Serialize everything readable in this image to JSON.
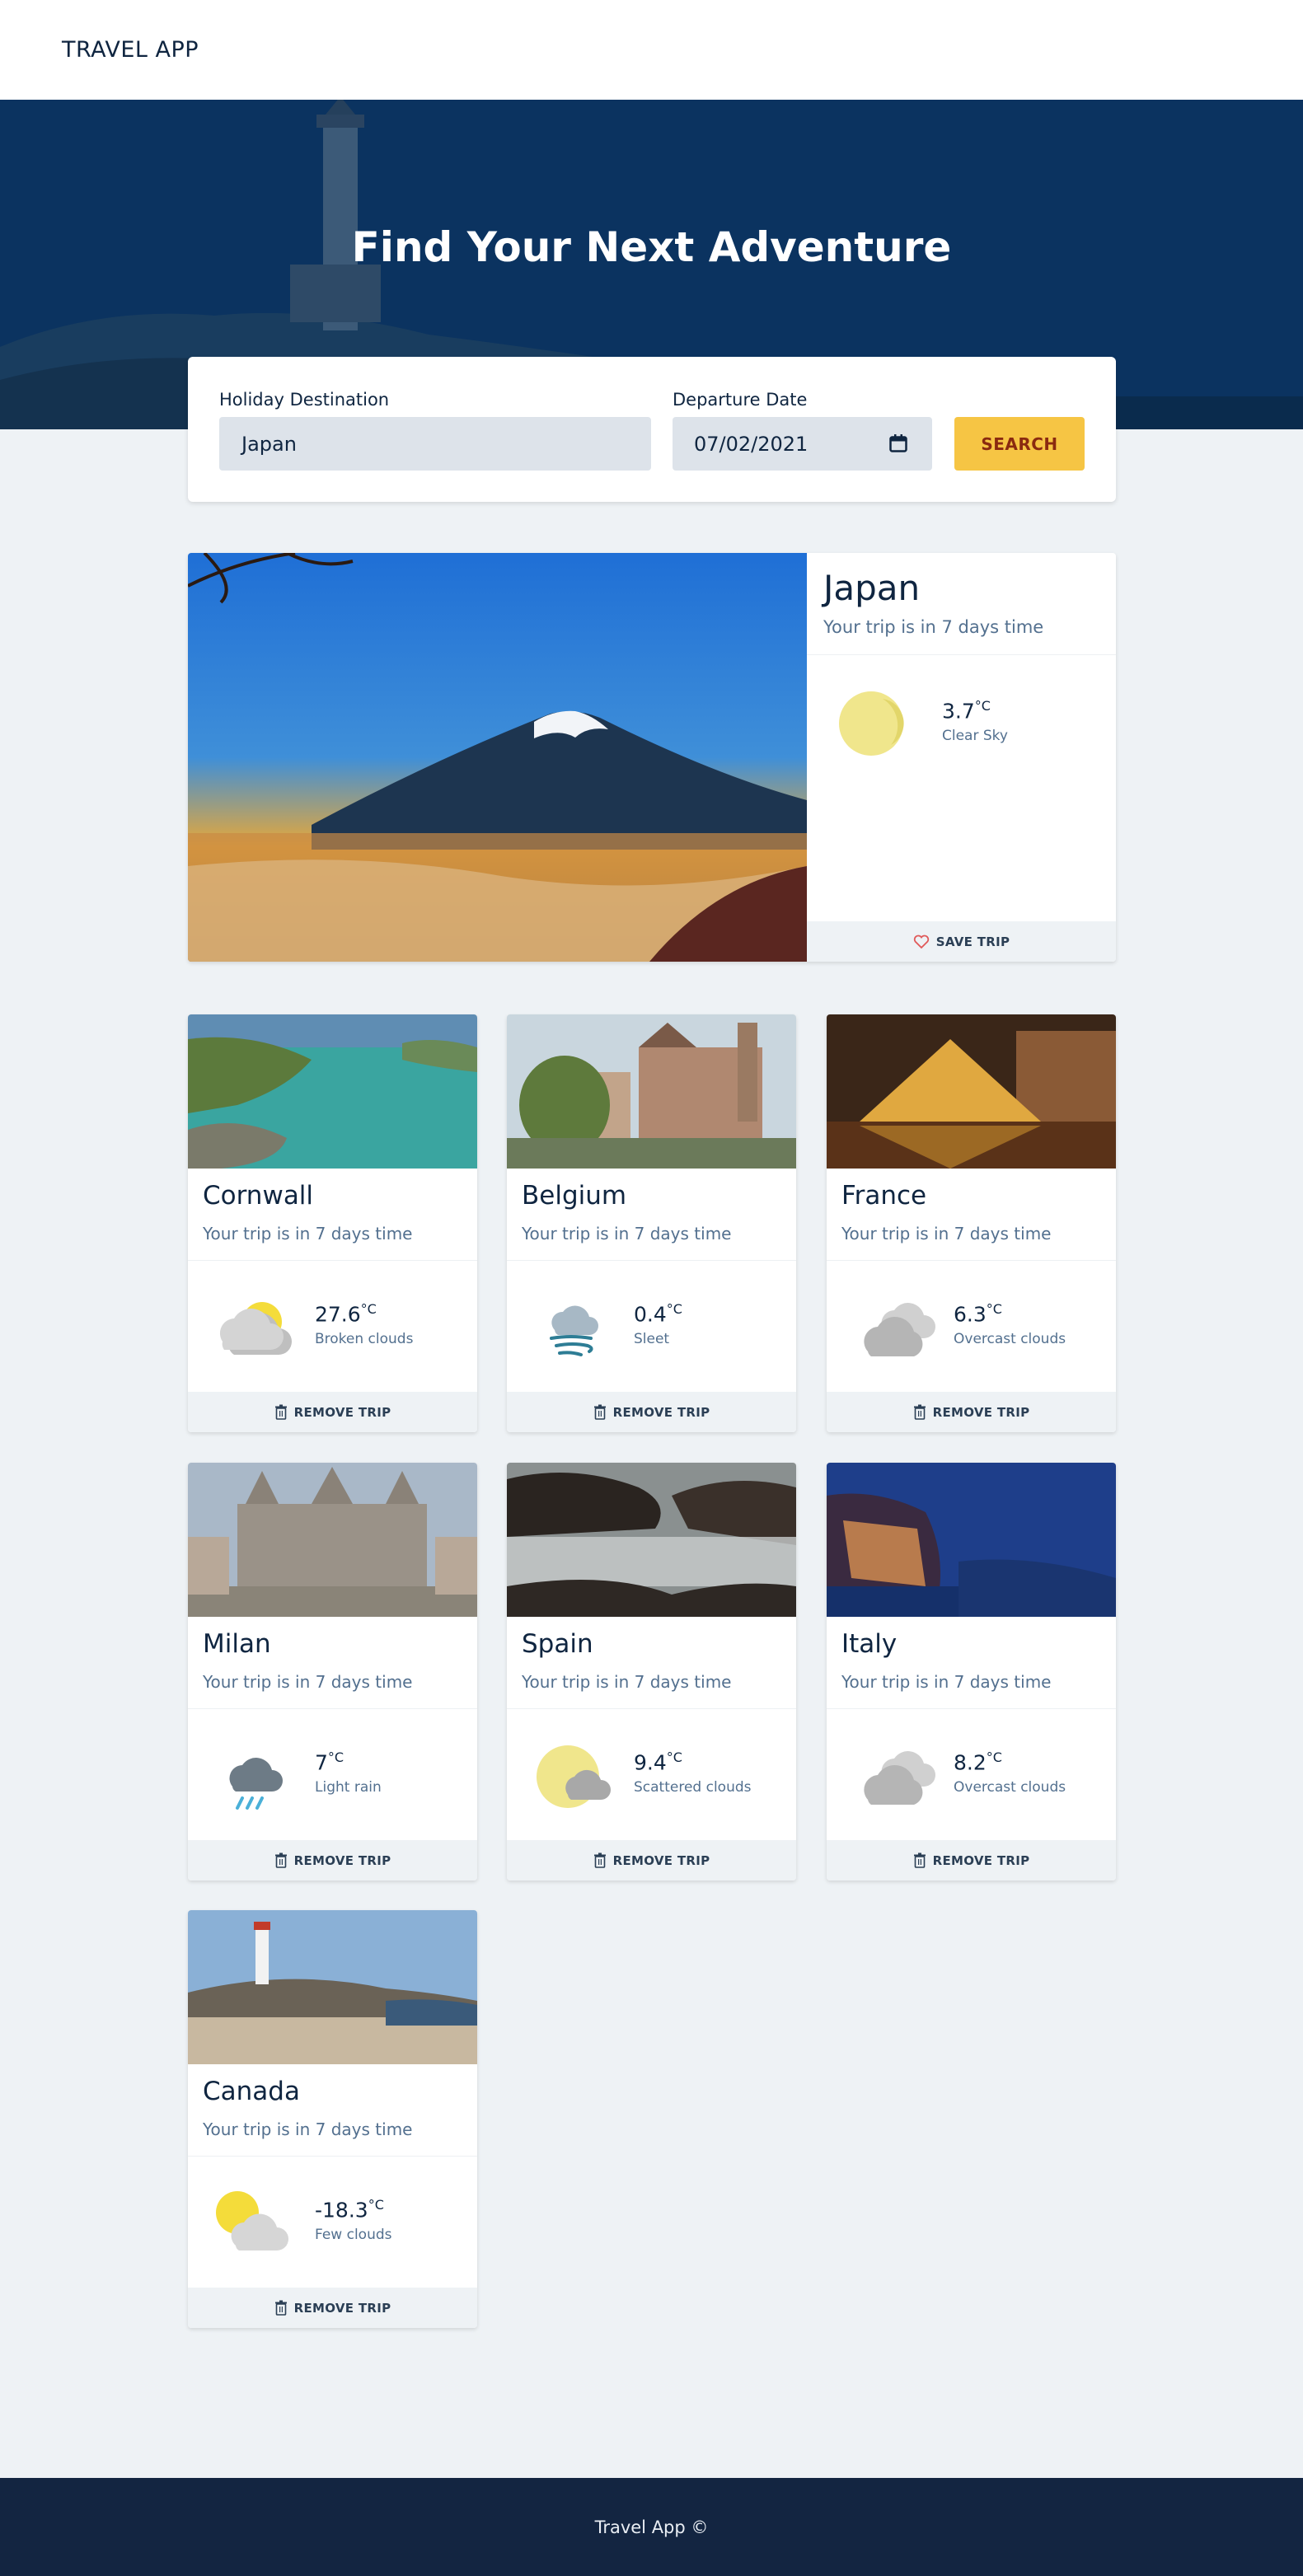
{
  "app": {
    "brand": "TRAVEL APP"
  },
  "hero": {
    "title": "Find Your Next Adventure"
  },
  "search": {
    "destination_label": "Holiday Destination",
    "destination_value": "Japan",
    "date_label": "Departure Date",
    "date_value": "07/02/2021",
    "button_label": "SEARCH"
  },
  "featured": {
    "title": "Japan",
    "subtitle": "Your trip is in 7 days time",
    "temp": "3.7",
    "unit": "°C",
    "desc": "Clear Sky",
    "weather_icon": "sun-icon",
    "action_label": "SAVE TRIP",
    "action_icon": "heart-icon"
  },
  "trips": [
    {
      "title": "Cornwall",
      "subtitle": "Your trip is in 7 days time",
      "temp": "27.6",
      "unit": "°C",
      "desc": "Broken clouds",
      "weather_icon": "broken-clouds-icon",
      "action_label": "REMOVE TRIP"
    },
    {
      "title": "Belgium",
      "subtitle": "Your trip is in 7 days time",
      "temp": "0.4",
      "unit": "°C",
      "desc": "Sleet",
      "weather_icon": "sleet-icon",
      "action_label": "REMOVE TRIP"
    },
    {
      "title": "France",
      "subtitle": "Your trip is in 7 days time",
      "temp": "6.3",
      "unit": "°C",
      "desc": "Overcast clouds",
      "weather_icon": "overcast-clouds-icon",
      "action_label": "REMOVE TRIP"
    },
    {
      "title": "Milan",
      "subtitle": "Your trip is in 7 days time",
      "temp": "7",
      "unit": "°C",
      "desc": "Light rain",
      "weather_icon": "light-rain-icon",
      "action_label": "REMOVE TRIP"
    },
    {
      "title": "Spain",
      "subtitle": "Your trip is in 7 days time",
      "temp": "9.4",
      "unit": "°C",
      "desc": "Scattered clouds",
      "weather_icon": "scattered-clouds-icon",
      "action_label": "REMOVE TRIP"
    },
    {
      "title": "Italy",
      "subtitle": "Your trip is in 7 days time",
      "temp": "8.2",
      "unit": "°C",
      "desc": "Overcast clouds",
      "weather_icon": "overcast-clouds-icon",
      "action_label": "REMOVE TRIP"
    },
    {
      "title": "Canada",
      "subtitle": "Your trip is in 7 days time",
      "temp": "-18.3",
      "unit": "°C",
      "desc": "Few clouds",
      "weather_icon": "few-clouds-icon",
      "action_label": "REMOVE TRIP"
    }
  ],
  "footer": {
    "text": "Travel App ©"
  },
  "colors": {
    "navy": "#132541",
    "accent": "#f6c544",
    "muted": "#53708f",
    "background": "#eef2f5"
  }
}
